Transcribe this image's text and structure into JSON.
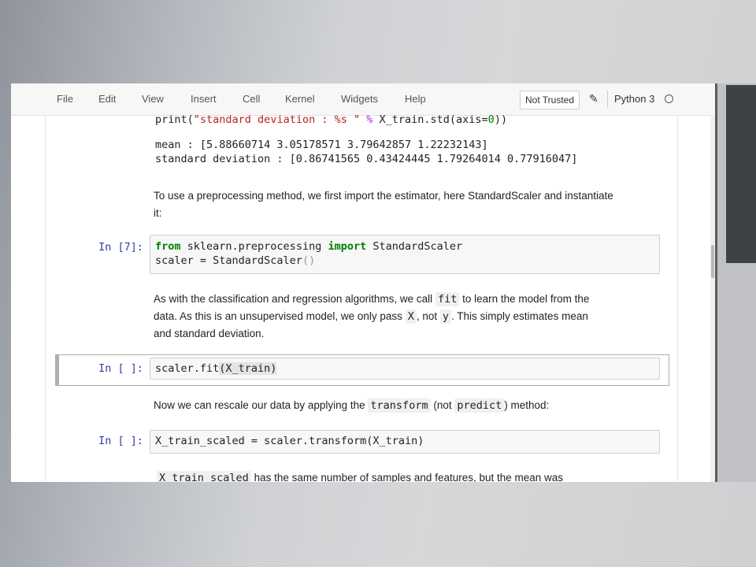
{
  "menu": {
    "items": [
      "File",
      "Edit",
      "View",
      "Insert",
      "Cell",
      "Kernel",
      "Widgets",
      "Help"
    ],
    "trust_label": "Not Trusted",
    "kernel_name": "Python 3"
  },
  "cells": {
    "prev_code_line": {
      "fn": "print",
      "lp": "(",
      "str": "\"standard deviation : %s \"",
      "op": " % ",
      "mid": "X_train.std(axis=",
      "num": "0",
      "end": "))"
    },
    "prev_output": [
      "mean : [5.88660714 3.05178571 3.79642857 1.22232143]",
      "standard deviation : [0.86741565 0.43424445 1.79264014 0.77916047]"
    ],
    "md1": {
      "line1": "To use a preprocessing method, we first import the estimator, here StandardScaler and instantiate",
      "line2": "it:"
    },
    "cell7": {
      "prompt": "In [7]:",
      "kw_from": "from",
      "module": " sklearn.preprocessing ",
      "kw_import": "import",
      "name": " StandardScaler",
      "line2_a": "scaler = StandardScaler",
      "line2_b": "()"
    },
    "md2": {
      "l1_a": "As with the classification and regression algorithms, we call",
      "l1_code": "fit",
      "l1_b": "to learn the model from the",
      "l2_a": "data. As this is an unsupervised model, we only pass",
      "l2_code1": "X",
      "l2_b": ", not",
      "l2_code2": "y",
      "l2_c": ". This simply estimates mean",
      "l3": "and standard deviation."
    },
    "cell_fit": {
      "prompt": "In [ ]:",
      "code_a": "scaler.fit",
      "code_b": "(X_train)"
    },
    "md3": {
      "a": "Now we can rescale our data by applying the",
      "code1": "transform",
      "b": "(not",
      "code2": "predict",
      "c": ") method:"
    },
    "cell_transform": {
      "prompt": "In [ ]:",
      "code": "X_train_scaled = scaler.transform(X_train)"
    },
    "md4": {
      "code": "X_train_scaled",
      "text": "has the same number of samples and features, but the mean was"
    }
  }
}
